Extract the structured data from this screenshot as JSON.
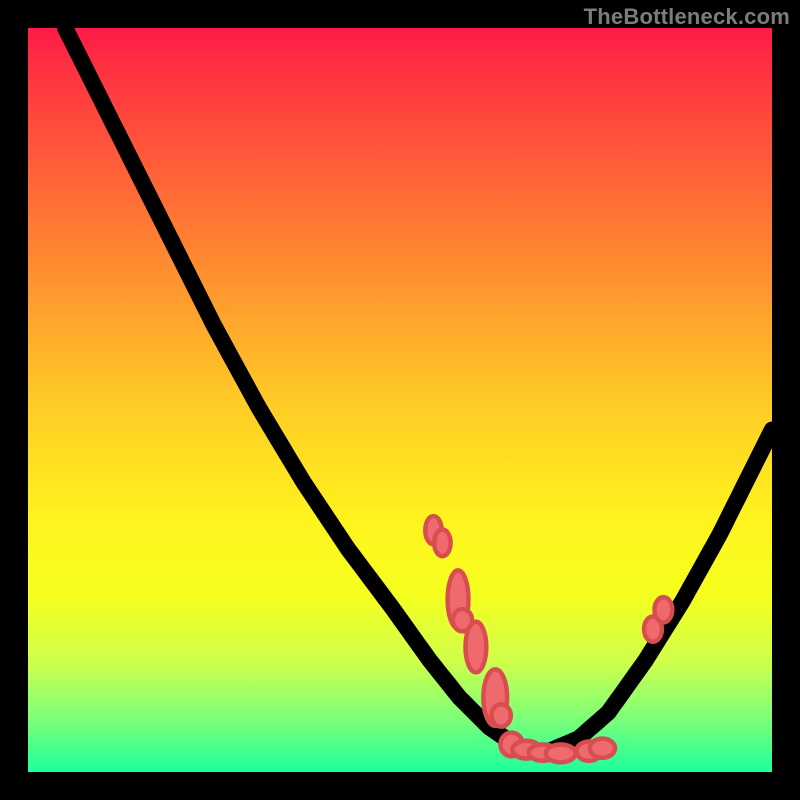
{
  "watermark": "TheBottleneck.com",
  "colors": {
    "marker_fill": "#ef6a6d",
    "marker_stroke": "#d84d50",
    "curve": "#000000"
  },
  "chart_data": {
    "type": "line",
    "title": "",
    "xlabel": "",
    "ylabel": "",
    "xlim": [
      0,
      100
    ],
    "ylim": [
      0,
      100
    ],
    "grid": false,
    "legend": false,
    "note": "Values are percentages of plot area; y=0 is bottom. Curve is a V-shaped bottleneck curve with minimum near x≈68."
  }
}
